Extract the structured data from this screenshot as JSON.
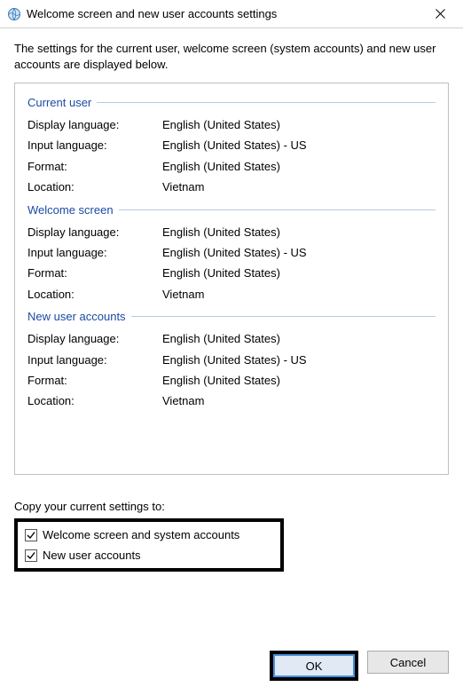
{
  "titlebar": {
    "title": "Welcome screen and new user accounts settings"
  },
  "intro": "The settings for the current user, welcome screen (system accounts) and new user accounts are displayed below.",
  "groups": {
    "current_user": {
      "header": "Current user",
      "display_language_label": "Display language:",
      "display_language_value": "English (United States)",
      "input_language_label": "Input language:",
      "input_language_value": "English (United States) - US",
      "format_label": "Format:",
      "format_value": "English (United States)",
      "location_label": "Location:",
      "location_value": "Vietnam"
    },
    "welcome_screen": {
      "header": "Welcome screen",
      "display_language_label": "Display language:",
      "display_language_value": "English (United States)",
      "input_language_label": "Input language:",
      "input_language_value": "English (United States) - US",
      "format_label": "Format:",
      "format_value": "English (United States)",
      "location_label": "Location:",
      "location_value": "Vietnam"
    },
    "new_user": {
      "header": "New user accounts",
      "display_language_label": "Display language:",
      "display_language_value": "English (United States)",
      "input_language_label": "Input language:",
      "input_language_value": "English (United States) - US",
      "format_label": "Format:",
      "format_value": "English (United States)",
      "location_label": "Location:",
      "location_value": "Vietnam"
    }
  },
  "copy": {
    "label": "Copy your current settings to:",
    "welcome_label": "Welcome screen and system accounts",
    "newuser_label": "New user accounts",
    "welcome_checked": true,
    "newuser_checked": true
  },
  "buttons": {
    "ok": "OK",
    "cancel": "Cancel"
  }
}
